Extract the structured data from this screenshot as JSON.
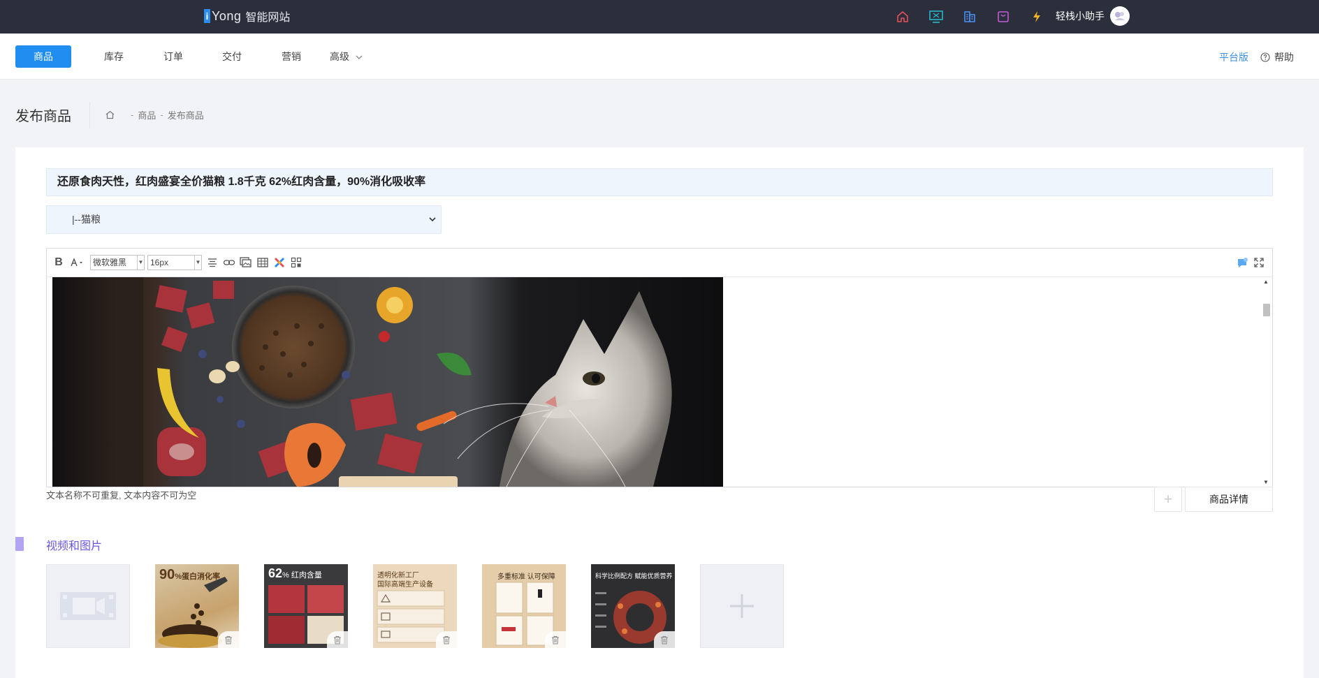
{
  "app": {
    "brand_mark": "i",
    "brand_name": "Yong",
    "brand_sub": "智能网站"
  },
  "topbar": {
    "icons": [
      {
        "name": "home-icon",
        "color": "#e8505b"
      },
      {
        "name": "monitor-icon",
        "color": "#25b8c9"
      },
      {
        "name": "building-icon",
        "color": "#4a8ef0"
      },
      {
        "name": "bag-icon",
        "color": "#c55bd8"
      },
      {
        "name": "lightning-icon",
        "color": "#f5b526"
      }
    ],
    "assistant_label": "轻栈小助手"
  },
  "nav": {
    "items": [
      {
        "label": "商品",
        "active": true
      },
      {
        "label": "库存"
      },
      {
        "label": "订单"
      },
      {
        "label": "交付"
      },
      {
        "label": "营销"
      },
      {
        "label": "高级"
      }
    ],
    "platform_label": "平台版",
    "help_label": "帮助"
  },
  "page": {
    "title": "发布商品",
    "breadcrumb": [
      "商品",
      "发布商品"
    ]
  },
  "form": {
    "product_title": "还原食肉天性，红肉盛宴全价猫粮 1.8千克 62%红肉含量，90%消化吸收率",
    "category": "|--猫粮",
    "editor": {
      "font_family": "微软雅黑",
      "font_size": "16px"
    },
    "hint": "文本名称不可重复, 文本内容不可为空",
    "detail_tab_label": "商品详情"
  },
  "media": {
    "section_title": "视频和图片",
    "images": [
      {
        "caption": "90",
        "caption_unit": "%蛋白消化率"
      },
      {
        "caption": "62",
        "caption_unit": "% 红肉含量"
      },
      {
        "caption": "透明化新工厂",
        "caption_sub": "国际高端生产设备"
      },
      {
        "caption": "多重标准 认可保障"
      },
      {
        "caption": "科学比例配方 赋能优质营养"
      }
    ]
  }
}
